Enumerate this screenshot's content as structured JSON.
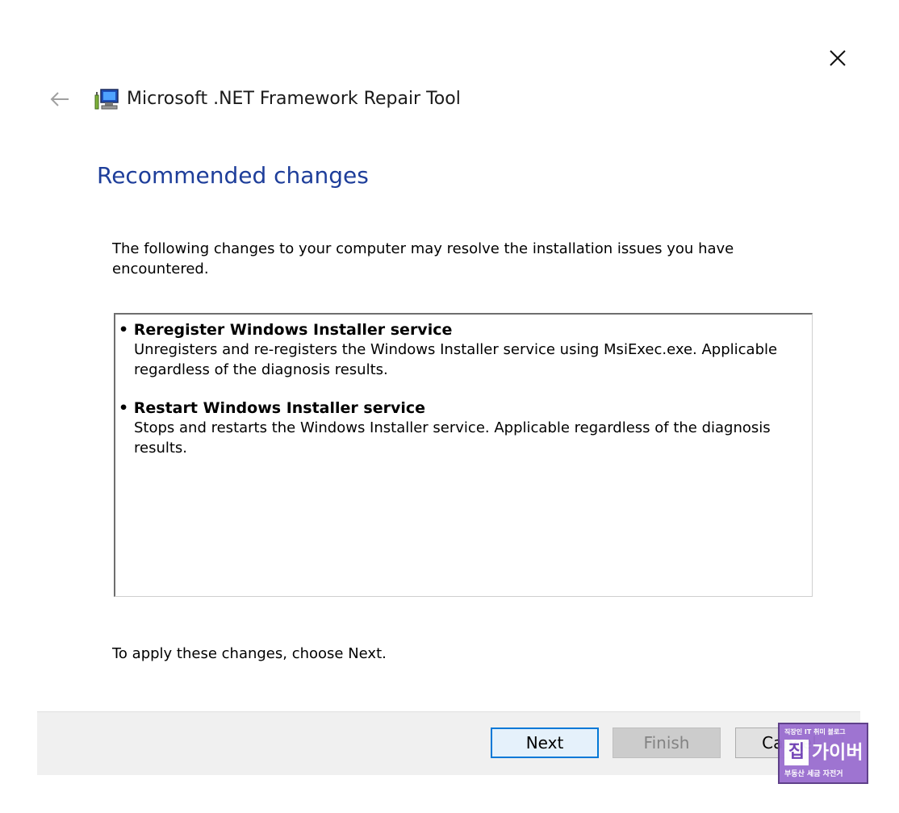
{
  "window": {
    "title": "Microsoft .NET Framework Repair Tool",
    "close_icon": "close-icon",
    "back_icon": "back-arrow-icon",
    "app_icon": "repair-tool-icon"
  },
  "content": {
    "heading": "Recommended changes",
    "intro": "The following changes to your computer may resolve the installation issues you have encountered.",
    "changes": [
      {
        "title": "Reregister Windows Installer service",
        "description": "Unregisters and re-registers the Windows Installer service using MsiExec.exe. Applicable regardless of the diagnosis results."
      },
      {
        "title": "Restart Windows Installer service",
        "description": "Stops and restarts the Windows Installer service. Applicable regardless of the diagnosis results."
      }
    ],
    "apply_text": "To apply these changes, choose Next."
  },
  "footer": {
    "next_label": "Next",
    "finish_label": "Finish",
    "cancel_label": "Cancel"
  },
  "watermark": {
    "top_text": "직장인 IT 취미 블로그",
    "badge_text": "집",
    "main_text": "가이버",
    "bottom_text": "부동산 세금 자전거"
  },
  "colors": {
    "heading": "#1e3e9a",
    "accent_border": "#0078d7",
    "footer_bg": "#f0f0f0",
    "watermark_bg": "#9b6fd0"
  }
}
